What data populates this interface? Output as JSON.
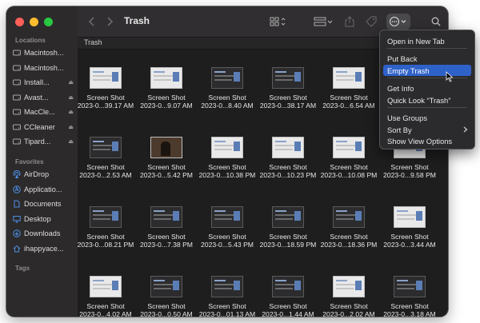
{
  "window": {
    "title": "Trash"
  },
  "path_label": "Trash",
  "sidebar": {
    "locations_label": "Locations",
    "locations": [
      {
        "label": "Macintosh...",
        "icon": "drive-icon",
        "eject": false
      },
      {
        "label": "Macintosh...",
        "icon": "drive-icon",
        "eject": false
      },
      {
        "label": "Install...",
        "icon": "drive-icon",
        "eject": true
      },
      {
        "label": "Avast...",
        "icon": "drive-icon",
        "eject": true
      },
      {
        "label": "MacCle...",
        "icon": "drive-icon",
        "eject": true
      },
      {
        "label": "CCleaner",
        "icon": "drive-icon",
        "eject": true
      },
      {
        "label": "Tipard...",
        "icon": "drive-icon",
        "eject": true
      }
    ],
    "favorites_label": "Favorites",
    "favorites": [
      {
        "label": "AirDrop",
        "icon": "airdrop-icon"
      },
      {
        "label": "Applicatio...",
        "icon": "applications-icon"
      },
      {
        "label": "Documents",
        "icon": "document-icon"
      },
      {
        "label": "Desktop",
        "icon": "desktop-icon"
      },
      {
        "label": "Downloads",
        "icon": "download-icon"
      },
      {
        "label": "ihappyace...",
        "icon": "home-icon"
      }
    ],
    "tags_label": "Tags",
    "eject_glyph": "⏏"
  },
  "files": {
    "name_line1": "Screen Shot",
    "items": [
      "2023-0...39.17 AM",
      "2023-0...9.07 AM",
      "2023-0...8.40 AM",
      "2023-0...38.17 AM",
      "2023-0...6.54 AM",
      "",
      "2023-0...2.53 AM",
      "2023-0...5.42 PM",
      "2023-0...10.38 PM",
      "2023-0...10.23 PM",
      "2023-0...10.08 PM",
      "2023-0...9.58 PM",
      "2023-0...08.21 PM",
      "2023-0...7.38 PM",
      "2023-0...5.43 PM",
      "2023-0...18.59 PM",
      "2023-0...18.36 PM",
      "2023-0...3.44 AM",
      "2023-0...4.02 AM",
      "2023-0...0.50 AM",
      "2023-0...01.13 AM",
      "2023-0...1.44 AM",
      "2023-0...2.02 AM",
      "2023-0...3.18 AM"
    ]
  },
  "menu": {
    "items": [
      "Open in New Tab",
      "Put Back",
      "Empty Trash",
      "Get Info",
      "Quick Look “Trash”",
      "Use Groups",
      "Sort By",
      "Show View Options"
    ],
    "active_index": 2
  },
  "colors": {
    "accent": "#2f62c9",
    "window_bg": "#1e1e1e",
    "sidebar_bg": "#2d2a2c"
  }
}
